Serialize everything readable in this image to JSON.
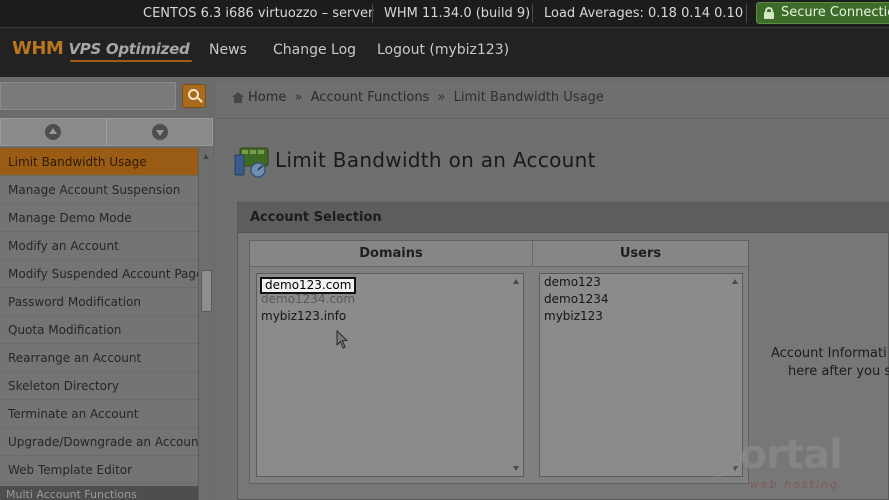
{
  "statusbar": {
    "server": "CENTOS 6.3 i686 virtuozzo – server",
    "version": "WHM 11.34.0 (build 9)",
    "load": "Load Averages: 0.18 0.14 0.10",
    "secure": "Secure Connection"
  },
  "header": {
    "logo_whm": "WHM",
    "logo_vps": "VPS Optimized",
    "nav": [
      "News",
      "Change Log",
      "Logout (mybiz123)"
    ]
  },
  "sidebar": {
    "search_value": "",
    "items": [
      {
        "label": "Limit Bandwidth Usage",
        "active": true
      },
      {
        "label": "Manage Account Suspension"
      },
      {
        "label": "Manage Demo Mode"
      },
      {
        "label": "Modify an Account"
      },
      {
        "label": "Modify Suspended Account Page"
      },
      {
        "label": "Password Modification"
      },
      {
        "label": "Quota Modification"
      },
      {
        "label": "Rearrange an Account"
      },
      {
        "label": "Skeleton Directory"
      },
      {
        "label": "Terminate an Account"
      },
      {
        "label": "Upgrade/Downgrade an Account"
      },
      {
        "label": "Web Template Editor"
      }
    ],
    "next_section": "Multi Account Functions"
  },
  "breadcrumb": {
    "home": "Home",
    "sep": "»",
    "account_functions": "Account Functions",
    "current": "Limit Bandwidth Usage"
  },
  "page": {
    "title": "Limit Bandwidth on an Account"
  },
  "account_selection": {
    "heading": "Account Selection",
    "domains_header": "Domains",
    "users_header": "Users",
    "domains": [
      "demo123.com",
      "demo1234.com",
      "mybiz123.info"
    ],
    "selected_domain": "demo123.com",
    "users": [
      "demo123",
      "demo1234",
      "mybiz123"
    ],
    "info_line1": "Account Informati",
    "info_line2": "here after you s"
  },
  "watermark": {
    "brand": "portal",
    "sub": "web hosting"
  },
  "colors": {
    "accent_orange": "#9a5c14",
    "secure_green": "#3c6b2a"
  }
}
